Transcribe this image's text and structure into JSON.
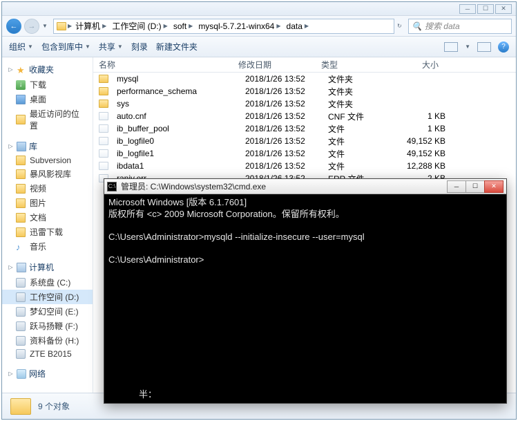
{
  "window": {
    "search_placeholder": "搜索 data"
  },
  "breadcrumbs": {
    "b0": "计算机",
    "b1": "工作空间 (D:)",
    "b2": "soft",
    "b3": "mysql-5.7.21-winx64",
    "b4": "data"
  },
  "toolbar": {
    "organize": "组织",
    "include": "包含到库中",
    "share": "共享",
    "burn": "刻录",
    "newfolder": "新建文件夹"
  },
  "cols": {
    "name": "名称",
    "date": "修改日期",
    "type": "类型",
    "size": "大小"
  },
  "sidebar": {
    "fav": "收藏夹",
    "dl": "下载",
    "desktop": "桌面",
    "recent": "最近访问的位置",
    "lib": "库",
    "svn": "Subversion",
    "bf": "暴风影视库",
    "video": "视频",
    "pic": "图片",
    "doc": "文档",
    "xl": "迅雷下载",
    "music": "音乐",
    "comp": "计算机",
    "c": "系统盘 (C:)",
    "d": "工作空间 (D:)",
    "e": "梦幻空间 (E:)",
    "f": "跃马扬鞭 (F:)",
    "h": "资料备份 (H:)",
    "zte": "ZTE B2015",
    "net": "网络"
  },
  "files": {
    "r0": {
      "n": "mysql",
      "d": "2018/1/26 13:52",
      "t": "文件夹",
      "s": ""
    },
    "r1": {
      "n": "performance_schema",
      "d": "2018/1/26 13:52",
      "t": "文件夹",
      "s": ""
    },
    "r2": {
      "n": "sys",
      "d": "2018/1/26 13:52",
      "t": "文件夹",
      "s": ""
    },
    "r3": {
      "n": "auto.cnf",
      "d": "2018/1/26 13:52",
      "t": "CNF 文件",
      "s": "1 KB"
    },
    "r4": {
      "n": "ib_buffer_pool",
      "d": "2018/1/26 13:52",
      "t": "文件",
      "s": "1 KB"
    },
    "r5": {
      "n": "ib_logfile0",
      "d": "2018/1/26 13:52",
      "t": "文件",
      "s": "49,152 KB"
    },
    "r6": {
      "n": "ib_logfile1",
      "d": "2018/1/26 13:52",
      "t": "文件",
      "s": "49,152 KB"
    },
    "r7": {
      "n": "ibdata1",
      "d": "2018/1/26 13:52",
      "t": "文件",
      "s": "12,288 KB"
    },
    "r8": {
      "n": "ranjy.err",
      "d": "2018/1/26 13:52",
      "t": "ERR 文件",
      "s": "2 KB"
    }
  },
  "status": {
    "count": "9 个对象"
  },
  "cmd": {
    "title": "管理员: C:\\Windows\\system32\\cmd.exe",
    "line1": "Microsoft Windows [版本 6.1.7601]",
    "line2": "版权所有 <c> 2009 Microsoft Corporation。保留所有权利。",
    "line3": "C:\\Users\\Administrator>mysqld --initialize-insecure --user=mysql",
    "line4": "C:\\Users\\Administrator>",
    "footer": "半："
  }
}
